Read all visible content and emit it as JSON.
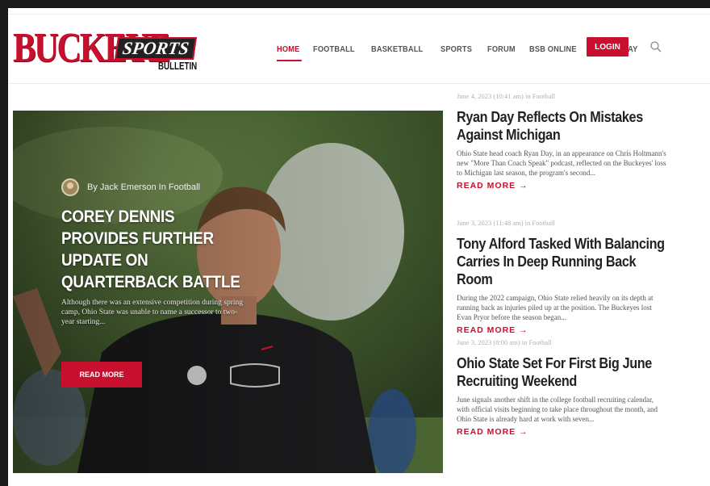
{
  "nav": {
    "items": [
      {
        "label": "HOME",
        "active": true
      },
      {
        "label": "FOOTBALL"
      },
      {
        "label": "BASKETBALL"
      },
      {
        "label": "SPORTS"
      },
      {
        "label": "FORUM"
      },
      {
        "label": "BSB ONLINE"
      },
      {
        "label": "EAT & STAY"
      }
    ],
    "login_label": "LOGIN",
    "search_icon": "search-icon"
  },
  "logo": {
    "main": "BUCKEYE",
    "script": "SPORTS",
    "sub": "BULLETIN"
  },
  "hero": {
    "byline": "By Jack Emerson In Football",
    "title": "COREY DENNIS PROVIDES FURTHER UPDATE ON QUARTERBACK BATTLE",
    "excerpt": "Although there was an extensive competition during spring camp, Ohio State was unable to name a successor to two-year starting...",
    "read_more": "READ MORE"
  },
  "posts": [
    {
      "date": "June 4, 2023 (10:41 am) in Football",
      "title": "Ryan Day Reflects On Mistakes Against Michigan",
      "excerpt": "Ohio State head coach Ryan Day, in an appearance on Chris Holtmann's new \"More Than Coach Speak\" podcast, reflected on the Buckeyes' loss to Michigan last season, the program's second...",
      "more": "READ MORE →"
    },
    {
      "date": "June 3, 2023 (11:48 am) in Football",
      "title": "Tony Alford Tasked With Balancing Carries In Deep Running Back Room",
      "excerpt": "During the 2022 campaign, Ohio State relied heavily on its depth at running back as injuries piled up at the position. The Buckeyes lost Evan Pryor before the season began...",
      "more": "READ MORE →"
    },
    {
      "date": "June 3, 2023 (8:00 am) in Football",
      "title": "Ohio State Set For First Big June Recruiting Weekend",
      "excerpt": "June signals another shift in the college football recruiting calendar, with official visits beginning to take place throughout the month, and Ohio State is already hard at work with seven...",
      "more": "READ MORE →"
    }
  ],
  "colors": {
    "accent": "#c8102e",
    "heading": "#222222",
    "muted": "#b0b0b0"
  }
}
